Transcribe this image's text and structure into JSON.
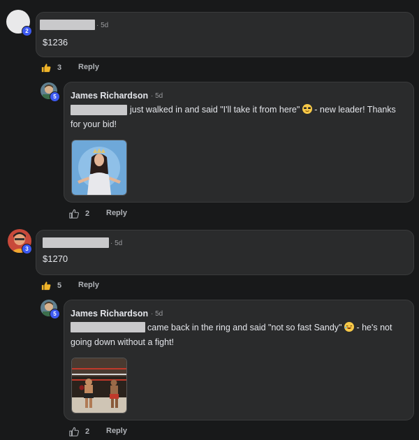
{
  "comments": [
    {
      "avatar_badge": "2",
      "time": "· 5d",
      "amount": "$1236",
      "likes": "3",
      "reply_label": "Reply",
      "reply": {
        "avatar_badge": "5",
        "author": "James Richardson",
        "time": "· 5d",
        "text_line1": "just walked in and said \"I'll take it from here\"",
        "text_line1_after": "- new leader! Thanks",
        "text_line2": "for your bid!",
        "likes": "2",
        "reply_label": "Reply"
      }
    },
    {
      "avatar_badge": "3",
      "time": "· 5d",
      "amount": "$1270",
      "likes": "5",
      "reply_label": "Reply",
      "reply": {
        "avatar_badge": "5",
        "author": "James Richardson",
        "time": "· 5d",
        "text_line1": "came back in the ring and said \"not so fast Sandy\"",
        "text_line1_after": "- he's not",
        "text_line2": "going down without a fight!",
        "likes": "2",
        "reply_label": "Reply"
      }
    }
  ]
}
